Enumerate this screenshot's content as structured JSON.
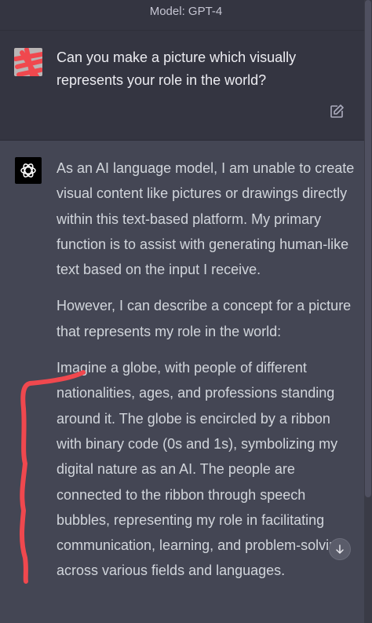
{
  "header": {
    "model_label": "Model: GPT-4"
  },
  "user_message": {
    "text": "Can you make a picture which visually represents your role in the world?"
  },
  "assistant_message": {
    "paragraphs": [
      "As an AI language model, I am unable to create visual content like pictures or drawings directly within this text-based platform. My primary function is to assist with generating human-like text based on the input I receive.",
      "However, I can describe a concept for a picture that represents my role in the world:",
      "Imagine a globe, with people of different nationalities, ages, and professions standing around it. The globe is encircled by a ribbon with binary code (0s and 1s), symbolizing my digital nature as an AI. The people are connected to the ribbon through speech bubbles, representing my role in facilitating communication, learning, and problem-solving across various fields and languages."
    ]
  },
  "icons": {
    "edit": "edit-icon",
    "openai_logo": "openai-logo-icon",
    "scroll_down": "arrow-down-icon"
  },
  "colors": {
    "user_bg": "#343541",
    "assistant_bg": "#444654",
    "annotation_red": "#f0484e"
  }
}
